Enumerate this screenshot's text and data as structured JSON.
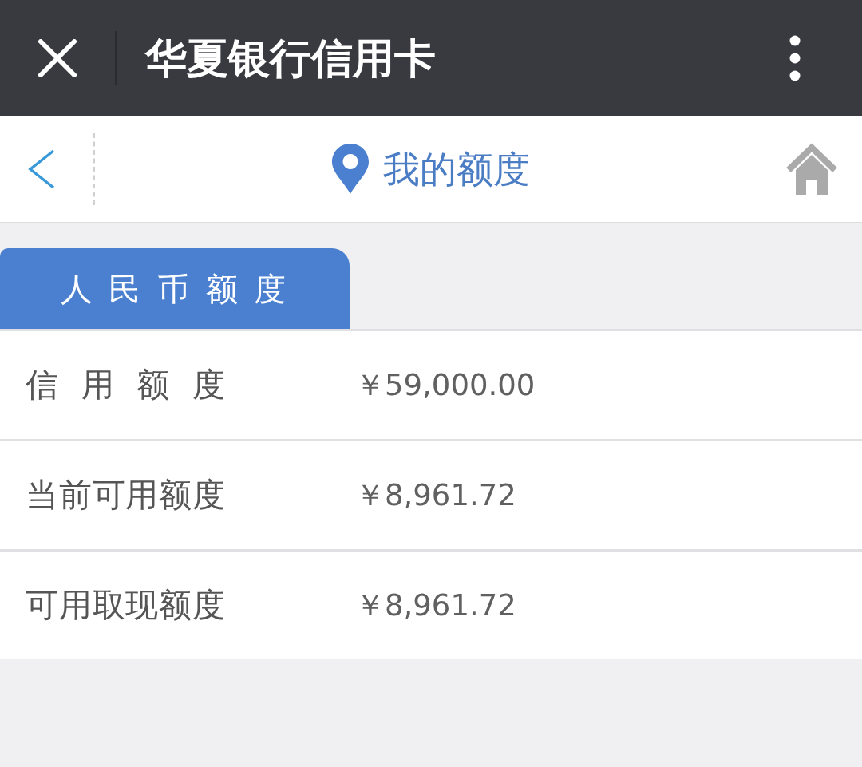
{
  "top_bar": {
    "title": "华夏银行信用卡"
  },
  "nav_bar": {
    "title": "我的额度"
  },
  "tabs": [
    {
      "label": "人 民 币 额 度",
      "selected": true
    }
  ],
  "rows": [
    {
      "label": "信 用 额 度",
      "value": "￥59,000.00"
    },
    {
      "label": "当前可用额度",
      "value": "￥8,961.72"
    },
    {
      "label": "可用取现额度",
      "value": "￥8,961.72"
    }
  ]
}
